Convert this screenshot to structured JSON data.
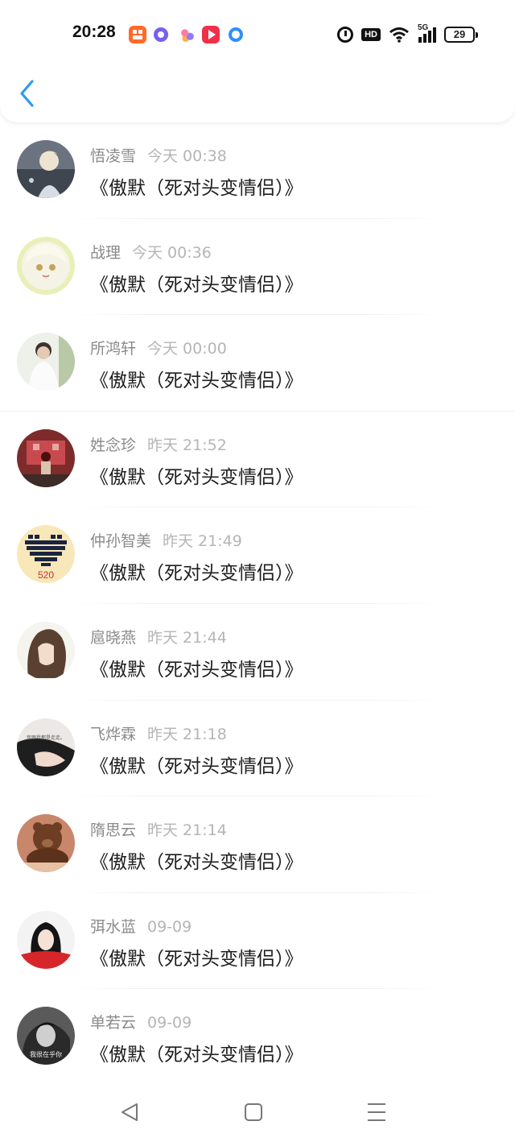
{
  "status_bar": {
    "time": "20:28",
    "hd_label": "HD",
    "network_label": "5G",
    "battery": "29"
  },
  "header": {
    "back_icon": "chevron-left-icon",
    "accent_color": "#2d9cf0"
  },
  "items": [
    {
      "name": "悟凌雪",
      "time": "今天 00:38",
      "title": "《傲默（死对头变情侣）》"
    },
    {
      "name": "战理",
      "time": "今天 00:36",
      "title": "《傲默（死对头变情侣）》"
    },
    {
      "name": "所鸿轩",
      "time": "今天 00:00",
      "title": "《傲默（死对头变情侣）》"
    },
    {
      "name": "姓念珍",
      "time": "昨天 21:52",
      "title": "《傲默（死对头变情侣）》"
    },
    {
      "name": "仲孙智美",
      "time": "昨天 21:49",
      "title": "《傲默（死对头变情侣）》"
    },
    {
      "name": "扈晓燕",
      "time": "昨天 21:44",
      "title": "《傲默（死对头变情侣）》"
    },
    {
      "name": "飞烨霖",
      "time": "昨天 21:18",
      "title": "《傲默（死对头变情侣）》"
    },
    {
      "name": "隋思云",
      "time": "昨天 21:14",
      "title": "《傲默（死对头变情侣）》"
    },
    {
      "name": "弭水蓝",
      "time": "09-09",
      "title": "《傲默（死对头变情侣）》"
    },
    {
      "name": "单若云",
      "time": "09-09",
      "title": "《傲默（死对头变情侣）》"
    }
  ],
  "avatar_images": {
    "4": {
      "text": "520"
    },
    "6": {
      "text": "我跟我都是走走。"
    },
    "9": {
      "text": "我很在乎你"
    }
  },
  "navbar": {
    "back_icon": "triangle-back-icon",
    "home_icon": "square-home-icon",
    "menu_icon": "menu-lines-icon"
  }
}
